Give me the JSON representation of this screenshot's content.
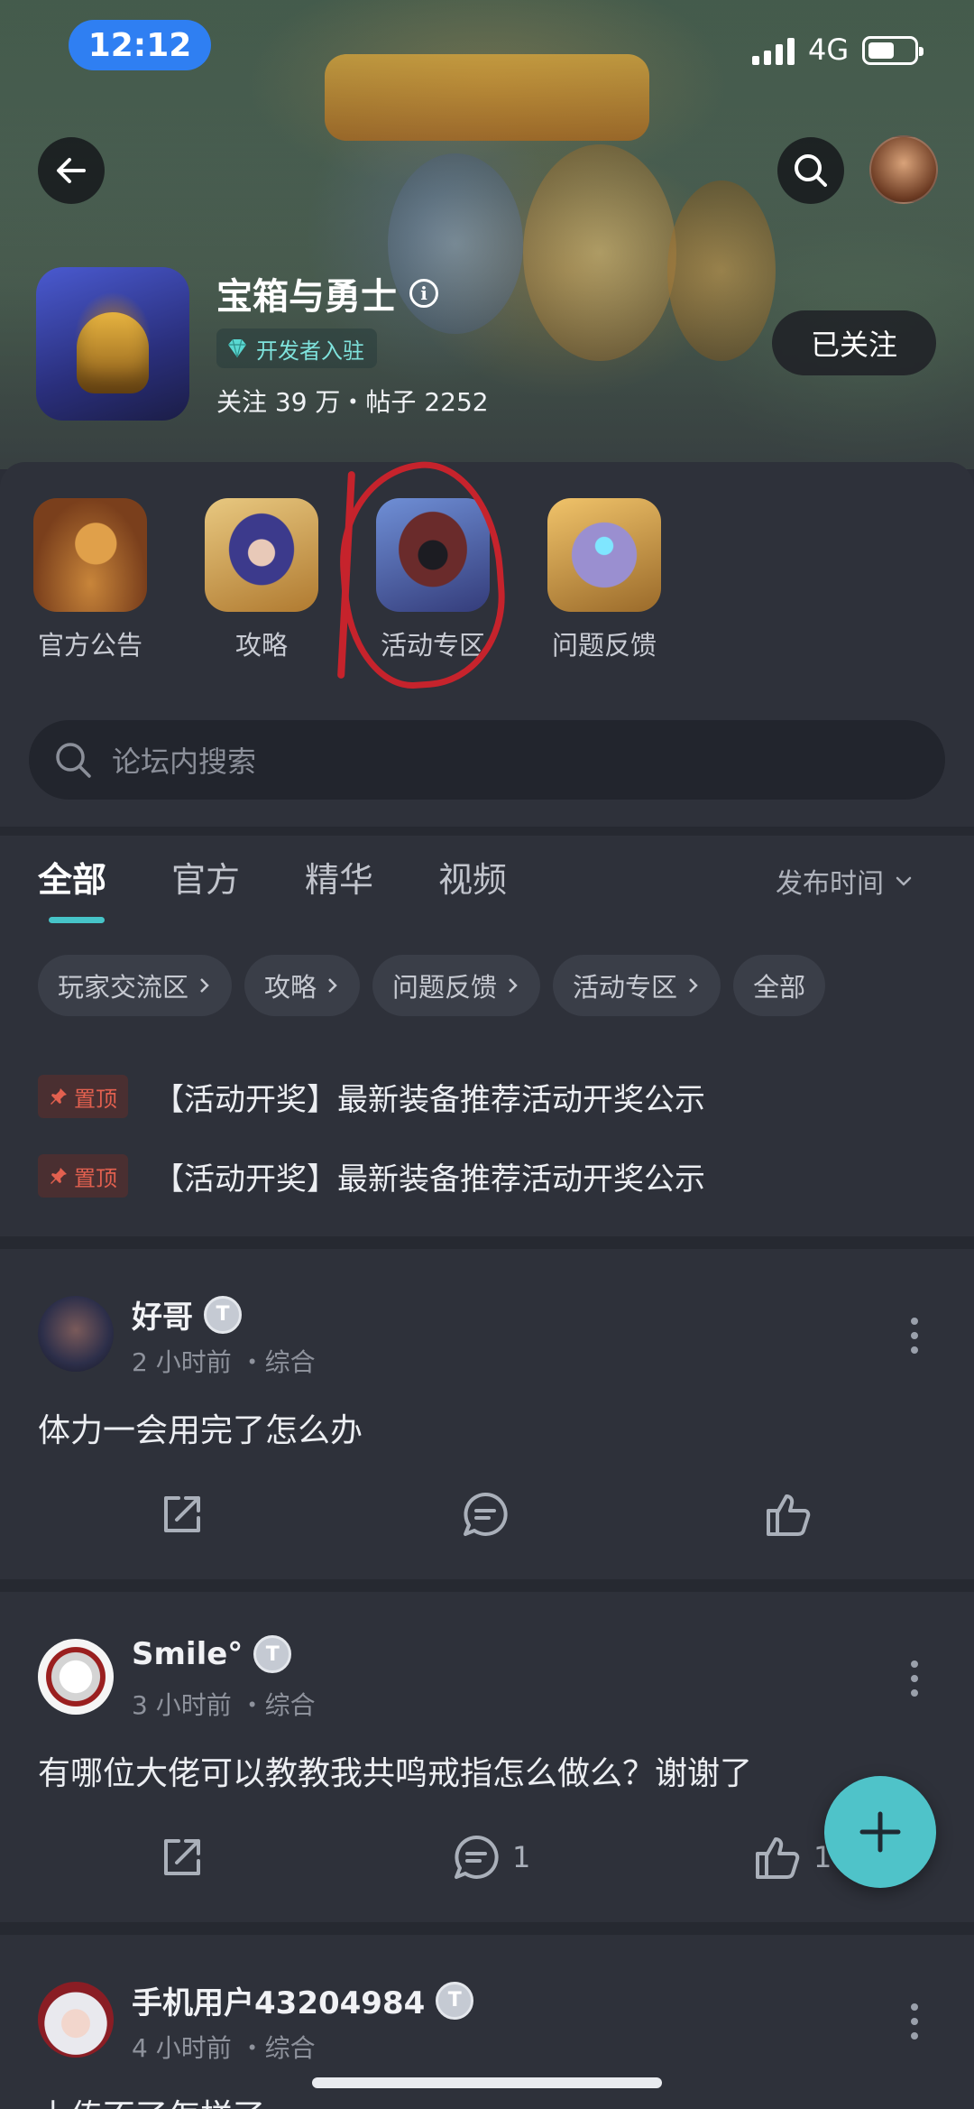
{
  "status_bar": {
    "time": "12:12",
    "network": "4G"
  },
  "header": {
    "game_name": "宝箱与勇士",
    "developer_badge": "开发者入驻",
    "stats": "关注 39 万・帖子 2252",
    "follow_label": "已关注"
  },
  "shortcuts": [
    {
      "label": "官方公告"
    },
    {
      "label": "攻略"
    },
    {
      "label": "活动专区"
    },
    {
      "label": "问题反馈"
    }
  ],
  "search": {
    "placeholder": "论坛内搜索"
  },
  "tabs": [
    {
      "label": "全部",
      "active": true
    },
    {
      "label": "官方"
    },
    {
      "label": "精华"
    },
    {
      "label": "视频"
    }
  ],
  "sort": {
    "label": "发布时间"
  },
  "chips": [
    {
      "label": "玩家交流区"
    },
    {
      "label": "攻略"
    },
    {
      "label": "问题反馈"
    },
    {
      "label": "活动专区"
    },
    {
      "label": "全部"
    }
  ],
  "pinned": [
    {
      "badge": "置顶",
      "text": "【活动开奖】最新装备推荐活动开奖公示"
    },
    {
      "badge": "置顶",
      "text": "【活动开奖】最新装备推荐活动开奖公示"
    }
  ],
  "posts": [
    {
      "user": "好哥",
      "level": "T",
      "meta": "2 小时前 ・综合",
      "content": "体力一会用完了怎么办",
      "comments": "",
      "likes": ""
    },
    {
      "user": "Smile°",
      "level": "T",
      "meta": "3 小时前 ・综合",
      "content": "有哪位大佬可以教教我共鸣戒指怎么做么？谢谢了",
      "comments": "1",
      "likes": "1"
    },
    {
      "user": "手机用户43204984",
      "level": "T",
      "meta": "4 小时前 ・综合",
      "content": "上传不了怎样了",
      "comments": "",
      "likes": ""
    }
  ],
  "colors": {
    "accent": "#4fc3c9",
    "pin": "#e2604f",
    "annotation": "#c6232c"
  }
}
